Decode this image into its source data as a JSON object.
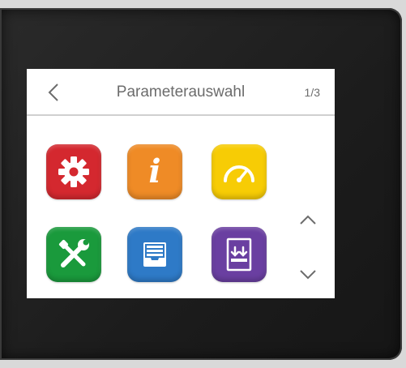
{
  "header": {
    "title": "Parameterauswahl",
    "page_indicator": "1/3",
    "back_icon": "chevron-left-icon"
  },
  "tiles": [
    {
      "icon": "gear-icon",
      "color": "#d4282f"
    },
    {
      "icon": "info-icon",
      "label": "i",
      "color": "#ef8b26"
    },
    {
      "icon": "gauge-icon",
      "color": "#f7cc05"
    },
    {
      "icon": "wrench-screwdriver-icon",
      "color": "#1a9a3c"
    },
    {
      "icon": "archive-tray-icon",
      "color": "#2e7ac7"
    },
    {
      "icon": "download-icon",
      "color": "#6a3fa1"
    }
  ],
  "navigation": {
    "up_icon": "chevron-up-icon",
    "down_icon": "chevron-down-icon"
  },
  "colors": {
    "bezel": "#1c1c1c",
    "screen": "#ffffff",
    "text": "#6c6c6c",
    "divider": "#d0d0d0"
  }
}
